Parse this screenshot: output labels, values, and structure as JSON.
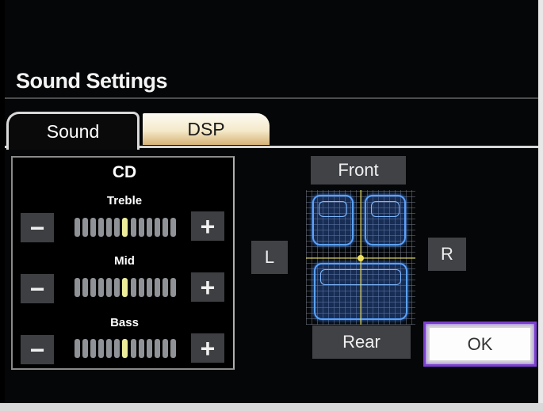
{
  "title": "Sound Settings",
  "tabs": [
    {
      "label": "Sound",
      "active": true
    },
    {
      "label": "DSP",
      "active": false
    }
  ],
  "source": "CD",
  "bands": [
    {
      "label": "Treble",
      "level": 7,
      "segments": 13
    },
    {
      "label": "Mid",
      "level": 7,
      "segments": 13
    },
    {
      "label": "Bass",
      "level": 7,
      "segments": 13
    }
  ],
  "controls": {
    "minus": "−",
    "plus": "+"
  },
  "balance": {
    "front": "Front",
    "rear": "Rear",
    "left": "L",
    "right": "R"
  },
  "ok_label": "OK",
  "colors": {
    "accent": "#7c3fd0",
    "seat": "#5aa2ff",
    "meter_on": "#ecec9a"
  }
}
